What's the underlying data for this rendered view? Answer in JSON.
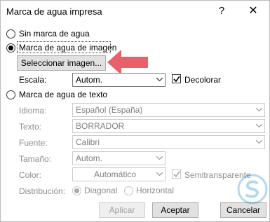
{
  "dialog": {
    "title": "Marca de agua impresa",
    "help": "?",
    "close": "✕"
  },
  "options": {
    "no_watermark": "Sin marca de agua",
    "image_watermark": "Marca de agua de imagen",
    "text_watermark": "Marca de agua de texto"
  },
  "image": {
    "select_button": "Seleccionar imagen...",
    "scale_label": "Escala:",
    "scale_value": "Autom.",
    "washout_label": "Decolorar"
  },
  "text": {
    "language_label": "Idioma:",
    "language_value": "Español (España)",
    "text_label": "Texto:",
    "text_value": "BORRADOR",
    "font_label": "Fuente:",
    "font_value": "Calibri",
    "size_label": "Tamaño:",
    "size_value": "Autom.",
    "color_label": "Color:",
    "color_value": "Automático",
    "semitransparent_label": "Semitransparente",
    "layout_label": "Distribución:",
    "diagonal_label": "Diagonal",
    "horizontal_label": "Horizontal"
  },
  "footer": {
    "apply": "Aplicar",
    "accept": "Aceptar",
    "cancel": "Cancelar"
  },
  "colors": {
    "arrow": "#e8616a"
  }
}
